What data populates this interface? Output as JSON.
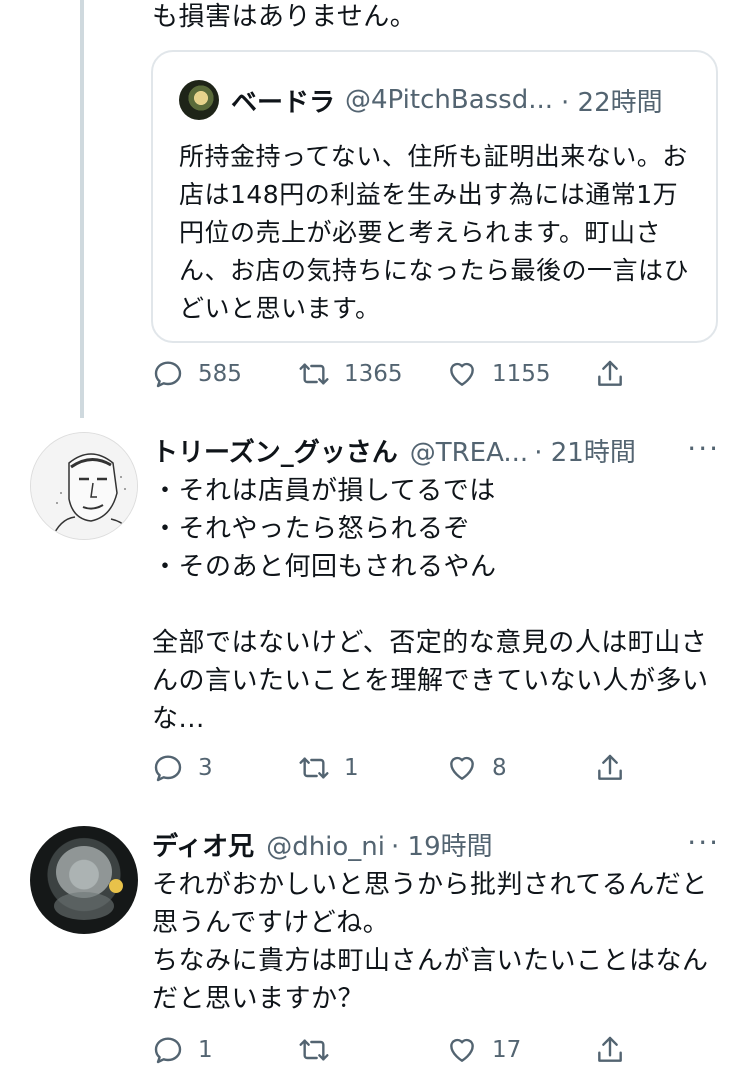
{
  "tweet1": {
    "tail_text": "も損害はありません。",
    "quote": {
      "name": "ベードラ",
      "handle": "@4PitchBassd...",
      "time": "· 22時間",
      "body": "所持金持ってない、住所も証明出来ない。お店は148円の利益を生み出す為には通常1万円位の売上が必要と考えられます。町山さん、お店の気持ちになったら最後の一言はひどいと思います。"
    },
    "replies": "585",
    "retweets": "1365",
    "likes": "1155"
  },
  "tweet2": {
    "name": "トリーズン_グッさん",
    "handle": "@TREA...",
    "time": "· 21時間",
    "more": "···",
    "body": "・それは店員が損してるでは\n・それやったら怒られるぞ\n・そのあと何回もされるやん\n\n全部ではないけど、否定的な意見の人は町山さんの言いたいことを理解できていない人が多いな...",
    "replies": "3",
    "retweets": "1",
    "likes": "8"
  },
  "tweet3": {
    "name": "ディオ兄",
    "handle": "@dhio_ni",
    "time": "· 19時間",
    "more": "···",
    "body": "それがおかしいと思うから批判されてるんだと思うんですけどね。\nちなみに貴方は町山さんが言いたいことはなんだと思いますか？",
    "replies": "1",
    "retweets": "",
    "likes": "17"
  },
  "icons": [
    "reply-icon",
    "retweet-icon",
    "like-icon",
    "share-icon",
    "more-icon"
  ],
  "colors": {
    "text": "#0f1419",
    "secondary": "#536471",
    "border": "#cfd9de"
  }
}
